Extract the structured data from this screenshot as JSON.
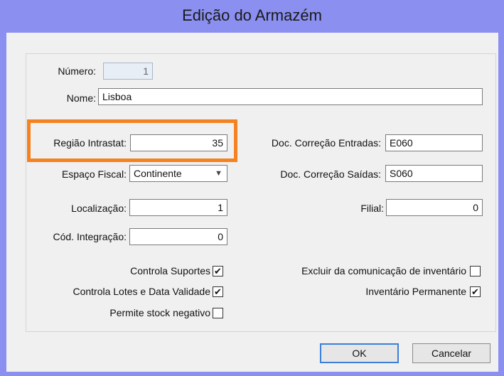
{
  "window": {
    "title": "Edição do Armazém"
  },
  "fields": {
    "numero": {
      "label": "Número:",
      "value": "1"
    },
    "nome": {
      "label": "Nome:",
      "value": "Lisboa"
    },
    "regiao_intrastat": {
      "label": "Região Intrastat:",
      "value": "35"
    },
    "espaco_fiscal": {
      "label": "Espaço Fiscal:",
      "value": "Continente"
    },
    "localizacao": {
      "label": "Localização:",
      "value": "1"
    },
    "cod_integracao": {
      "label": "Cód. Integração:",
      "value": "0"
    },
    "doc_correcao_entradas": {
      "label": "Doc. Correção  Entradas:",
      "value": "E060"
    },
    "doc_correcao_saidas": {
      "label": "Doc. Correção Saídas:",
      "value": "S060"
    },
    "filial": {
      "label": "Filial:",
      "value": "0"
    }
  },
  "checkboxes": {
    "controla_suportes": {
      "label": "Controla Suportes",
      "checked": true,
      "mark": "✔"
    },
    "controla_lotes": {
      "label": "Controla Lotes e Data Validade",
      "checked": true,
      "mark": "✔"
    },
    "permite_stock_negativo": {
      "label": "Permite stock negativo",
      "checked": false,
      "mark": ""
    },
    "excluir_comunicacao": {
      "label": "Excluir da comunicação de inventário",
      "checked": false,
      "mark": ""
    },
    "inventario_permanente": {
      "label": "Inventário Permanente",
      "checked": true,
      "mark": "✔"
    }
  },
  "buttons": {
    "ok": "OK",
    "cancel": "Cancelar"
  },
  "icons": {
    "dropdown": "▼"
  },
  "colors": {
    "titlebar": "#8a8ff0",
    "highlight": "#f58220",
    "default_button_border": "#3c7fd9"
  }
}
